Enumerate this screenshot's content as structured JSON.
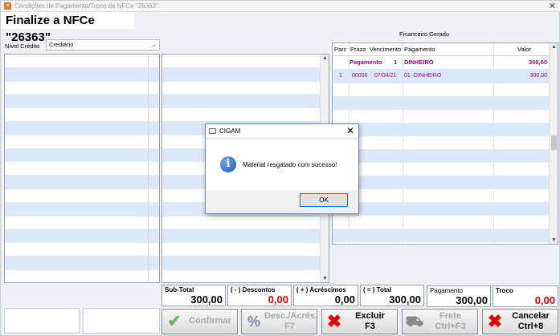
{
  "window": {
    "title": "Condições de Pagamento/Troco da NFCe \"26363\"",
    "close": "✕"
  },
  "heading": "Finalize a NFCe \"26363\"",
  "credito": {
    "label": "Nível Crédito",
    "value": "Crediário"
  },
  "financeiro": {
    "title": "Financeiro Gerado",
    "headers": {
      "parc": "Parc",
      "prazo": "Prazo",
      "vencimento": "Vencimento",
      "pagamento": "Pagamento",
      "valor": "Valor"
    },
    "summary": {
      "label": "Pagamento",
      "num": "1",
      "tipo": "DINHEIRO",
      "valor": "300,00"
    },
    "rows": [
      {
        "parc": "1",
        "prazo": "00000",
        "vencimento": "07/04/21",
        "pagamento": "01 -DINHEIRO",
        "valor": "300,00"
      }
    ]
  },
  "totals": {
    "subtotal": {
      "label": "Sub-Total",
      "value": "300,00"
    },
    "descontos": {
      "label": "( - ) Descontos",
      "value": "0,00"
    },
    "acrescimos": {
      "label": "( + ) Acréscimos",
      "value": "0,00"
    },
    "total": {
      "label": "( = ) Total",
      "value": "300,00"
    },
    "pagamento": {
      "label": "Pagamento",
      "value": "300,00"
    },
    "troco": {
      "label": "Troco",
      "value": "0,00"
    }
  },
  "buttons": {
    "confirmar": {
      "label": "Confirmar"
    },
    "desc": {
      "label": "Desc./Acrés.",
      "key": "F7"
    },
    "excluir": {
      "label": "Excluir",
      "key": "F3"
    },
    "frete": {
      "label": "Frete",
      "key": "Ctrl+F3"
    },
    "cancelar": {
      "label": "Cancelar",
      "key": "Ctrl+8"
    }
  },
  "dialog": {
    "title": "CIGAM",
    "message": "Material resgatado com sucesso!",
    "ok": "OK",
    "icon": "info-icon"
  },
  "colors": {
    "accent_text": "#8a0a8a",
    "negative": "#e00000",
    "dialog_border": "#0078d7"
  }
}
